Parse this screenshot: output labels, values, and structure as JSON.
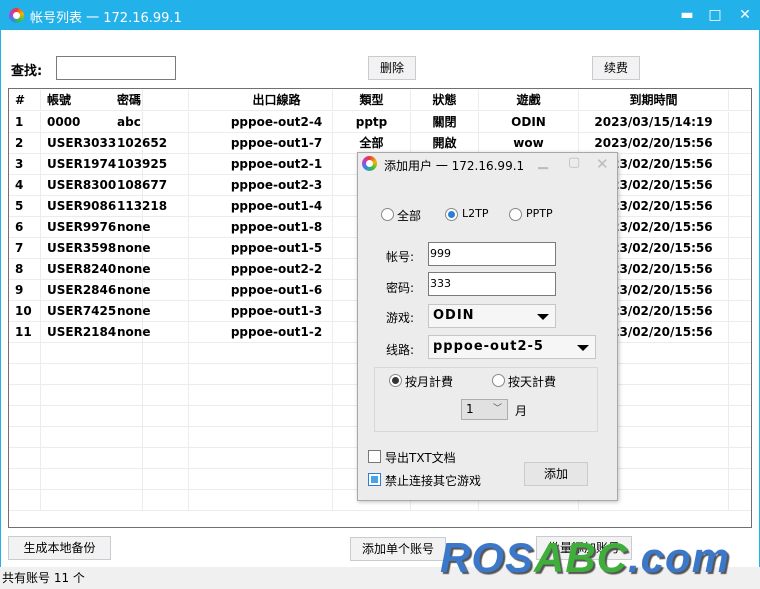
{
  "window": {
    "title": "帐号列表 一 172.16.99.1",
    "minimize": "▬",
    "maximize": "□",
    "close": "✕"
  },
  "toolbar": {
    "search_label": "查找:",
    "search_value": "",
    "delete_label": "删除",
    "renew_label": "续费"
  },
  "table": {
    "headers": [
      "#",
      "帳號",
      "密碼",
      "出口線路",
      "類型",
      "狀態",
      "遊戲",
      "到期時間"
    ],
    "rows": [
      [
        "1",
        "0000",
        "abc",
        "pppoe-out2-4",
        "pptp",
        "關閉",
        "ODIN",
        "2023/03/15/14:19"
      ],
      [
        "2",
        "USER3033",
        "102652",
        "pppoe-out1-7",
        "全部",
        "開啟",
        "wow",
        "2023/02/20/15:56"
      ],
      [
        "3",
        "USER1974",
        "103925",
        "pppoe-out2-1",
        "",
        "",
        "",
        "2023/02/20/15:56"
      ],
      [
        "4",
        "USER8300",
        "108677",
        "pppoe-out2-3",
        "",
        "",
        "",
        "2023/02/20/15:56"
      ],
      [
        "5",
        "USER9086",
        "113218",
        "pppoe-out1-4",
        "",
        "",
        "",
        "2023/02/20/15:56"
      ],
      [
        "6",
        "USER9976",
        "none",
        "pppoe-out1-8",
        "",
        "",
        "",
        "2023/02/20/15:56"
      ],
      [
        "7",
        "USER3598",
        "none",
        "pppoe-out1-5",
        "",
        "",
        "",
        "2023/02/20/15:56"
      ],
      [
        "8",
        "USER8240",
        "none",
        "pppoe-out2-2",
        "",
        "",
        "",
        "2023/02/20/15:56"
      ],
      [
        "9",
        "USER2846",
        "none",
        "pppoe-out1-6",
        "",
        "",
        "",
        "2023/02/20/15:56"
      ],
      [
        "10",
        "USER7425",
        "none",
        "pppoe-out1-3",
        "",
        "",
        "",
        "2023/02/20/15:56"
      ],
      [
        "11",
        "USER2184",
        "none",
        "pppoe-out1-2",
        "",
        "",
        "",
        "2023/02/20/15:56"
      ]
    ]
  },
  "bottom": {
    "backup_label": "生成本地备份",
    "add_single_label": "添加单个账号",
    "batch_add_label": "批量添加账号"
  },
  "status": {
    "text": "共有账号 11 个"
  },
  "watermark": {
    "text": "ROSABC.com"
  },
  "dialog": {
    "title": "添加用户 一 172.16.99.1",
    "types": [
      {
        "label": "全部",
        "checked": false
      },
      {
        "label": "L2TP",
        "checked": true
      },
      {
        "label": "PPTP",
        "checked": false
      }
    ],
    "account_label": "帐号:",
    "account_value": "999",
    "password_label": "密码:",
    "password_value": "333",
    "game_label": "游戏:",
    "game_value": "ODIN",
    "line_label": "线路:",
    "line_value": "pppoe-out2-5",
    "billing": [
      {
        "label": "按月計費",
        "checked": true
      },
      {
        "label": "按天計費",
        "checked": false
      }
    ],
    "months_value": "1",
    "months_unit": "月",
    "export_label": "导出TXT文档",
    "export_checked": false,
    "block_label": "禁止连接其它游戏",
    "block_checked": true,
    "add_label": "添加"
  }
}
